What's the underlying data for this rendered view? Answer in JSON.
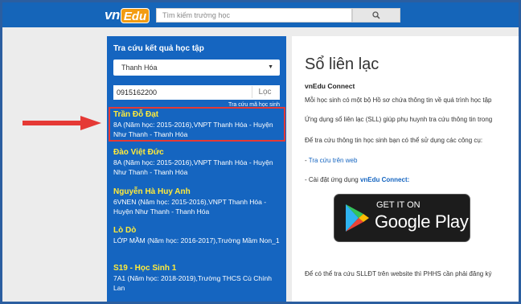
{
  "header": {
    "logo_vn": "vn",
    "logo_edu": "Edu",
    "search_placeholder": "Tìm kiếm trường học"
  },
  "sidebar": {
    "title": "Tra cứu kết quả học tập",
    "province": "Thanh Hóa",
    "phone": "0915162200",
    "lookup_button": "Lọc",
    "lookup_link": "Tra cứu mã học sinh",
    "students": [
      {
        "name": "Trần Đỗ Đạt",
        "detail": "8A (Năm học: 2015-2016),VNPT Thanh Hóa - Huyện Như Thanh - Thanh Hóa"
      },
      {
        "name": "Đào Việt Đức",
        "detail": "8A (Năm học: 2015-2016),VNPT Thanh Hóa - Huyện Như Thanh - Thanh Hóa"
      },
      {
        "name": "Nguyễn Hà Huy Anh",
        "detail": "6VNEN (Năm học: 2015-2016),VNPT Thanh Hóa - Huyện Như Thanh - Thanh Hóa"
      },
      {
        "name": "Lò Dò",
        "detail": "LỚP MẦM (Năm học: 2016-2017),Trường Mầm Non_1"
      },
      {
        "name": "S19 - Học Sinh 1",
        "detail": "7A1 (Năm học: 2018-2019),Trường THCS Cù Chính Lan"
      }
    ]
  },
  "content": {
    "title": "Sổ liên lạc",
    "subtitle": "vnEdu Connect",
    "line1": "Mỗi học sinh có một bộ Hồ sơ chứa thông tin về quá trình học tập",
    "line2": "Ứng dụng sổ liên lạc (SLL) giúp phụ huynh tra cứu thông tin trong",
    "line3": "Để tra cứu thông tin học sinh bạn có thể sử dụng các công cụ:",
    "bullet1_prefix": "- ",
    "bullet1_link": "Tra cứu trên web",
    "bullet2_prefix": "- Cài đặt ứng dụng ",
    "bullet2_link": "vnEdu Connect:",
    "footer": "Để có thể tra cứu SLLĐT trên website thì PHHS cần phải đăng ký",
    "google_play_top": "GET IT ON",
    "google_play_main": "Google Play"
  },
  "colors": {
    "header": "#1565b9",
    "panel": "#1565c0",
    "name": "#ffeb3b",
    "highlight": "#e53935"
  }
}
